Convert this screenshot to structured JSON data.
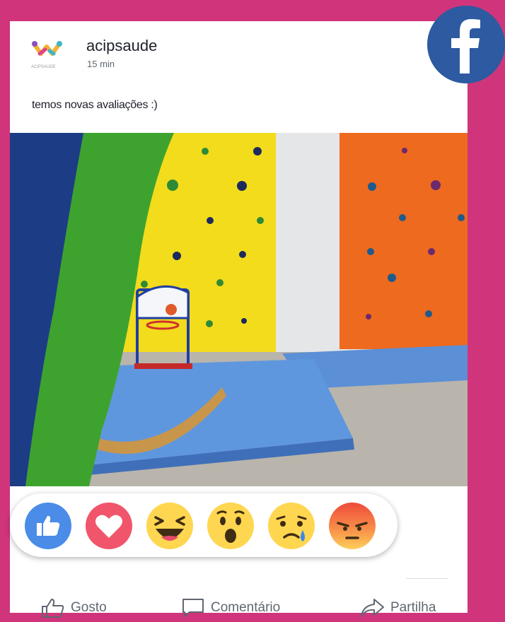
{
  "post": {
    "page_name": "acipsaude",
    "time": "15 min",
    "caption": "temos novas avaliações :)"
  },
  "brand": {
    "icon": "facebook-icon",
    "color": "#2d5aa0"
  },
  "reactions": [
    {
      "name": "like",
      "icon": "thumbs-up-icon"
    },
    {
      "name": "love",
      "icon": "heart-icon"
    },
    {
      "name": "haha",
      "icon": "laughing-face-icon"
    },
    {
      "name": "wow",
      "icon": "surprised-face-icon"
    },
    {
      "name": "sad",
      "icon": "crying-face-icon"
    },
    {
      "name": "angry",
      "icon": "angry-face-icon"
    }
  ],
  "actions": {
    "like_label": "Gosto",
    "comment_label": "Comentário",
    "share_label": "Partilha"
  },
  "colors": {
    "background": "#d0357c",
    "like_blue": "#4a8ce8",
    "love_red": "#f0556b",
    "emoji_yellow": "#ffd650"
  }
}
